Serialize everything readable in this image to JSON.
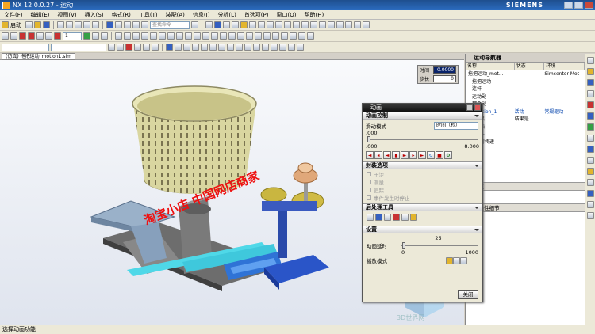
{
  "window": {
    "title": "NX 12.0.0.27 - 运动",
    "brand": "SIEMENS"
  },
  "menu": [
    "文件(F)",
    "编辑(E)",
    "视图(V)",
    "插入(S)",
    "格式(R)",
    "工具(T)",
    "装配(A)",
    "信息(I)",
    "分析(L)",
    "首选项(P)",
    "窗口(O)",
    "帮助(H)"
  ],
  "toolbar": {
    "start_label": "启动",
    "layer_value": "1",
    "search_placeholder": "查找命令"
  },
  "tab": {
    "label": "(仿真) 拖把运动_motion1.sim"
  },
  "time_panel": {
    "time_label": "时间",
    "time_value": "0.0000",
    "step_label": "步长",
    "step_value": "0"
  },
  "navigator": {
    "title": "运动导航器",
    "columns": [
      "名称",
      "状态",
      "环境"
    ],
    "rows": [
      {
        "name": "拖把运动_mot...",
        "status": "",
        "env": "Simcenter Mot"
      },
      {
        "name": "拖把运动",
        "status": "",
        "env": ""
      },
      {
        "name": "连杆",
        "status": "",
        "env": ""
      },
      {
        "name": "运动副",
        "status": "",
        "env": ""
      },
      {
        "name": "耦合副",
        "status": "",
        "env": ""
      },
      {
        "name": "Solution_1",
        "status": "活动",
        "env": "常规驱动"
      },
      {
        "name": "结果",
        "status": "结果是...",
        "env": ""
      },
      {
        "name": "动画",
        "status": "",
        "env": ""
      },
      {
        "name": "XY - ...",
        "status": "",
        "env": ""
      },
      {
        "name": "载荷传递",
        "status": "",
        "env": ""
      }
    ],
    "preview_label": "预览",
    "details_label": "依赖性细节"
  },
  "dialog": {
    "title": "动画",
    "sections": {
      "control": "动画控制",
      "package": "封装选项",
      "post": "后处理工具",
      "settings": "设置"
    },
    "slider_mode_label": "滑动模式",
    "slider_mode_value": "时间（秒）",
    "time_start": ".000",
    "time_end": "8.000",
    "time_current": ".000",
    "package_options": [
      "干涉",
      "测量",
      "追踪",
      "事件发生时停止"
    ],
    "delay_label": "动画延时",
    "delay_value": "25",
    "delay_min": "0",
    "delay_max": "1000",
    "play_mode_label": "播放模式",
    "close_label": "关闭"
  },
  "watermark": {
    "shop": "淘宝小店 中国网店商家",
    "site": "3D世界网"
  },
  "status": {
    "text": "选择动画功能"
  }
}
